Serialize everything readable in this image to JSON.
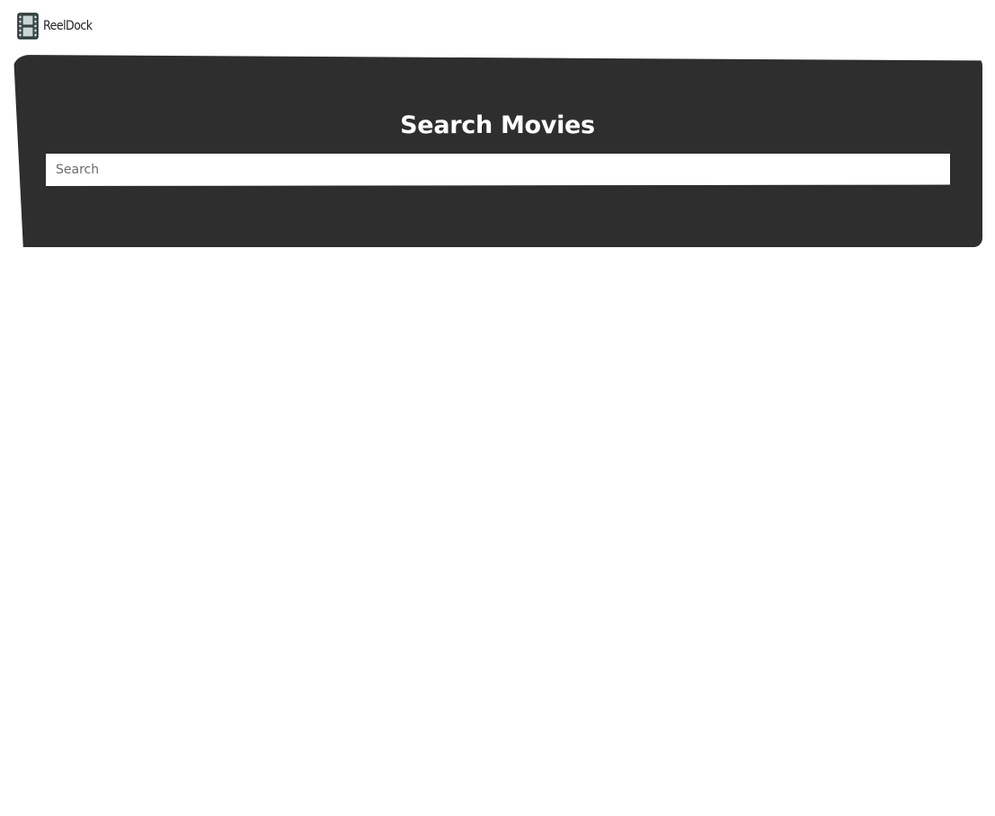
{
  "header": {
    "brand_name": "ReelDock",
    "logo_icon": "film-strip-icon"
  },
  "hero": {
    "title": "Search Movies",
    "search": {
      "placeholder": "Search",
      "value": ""
    }
  },
  "colors": {
    "hero_background": "#2e2e2e",
    "hero_text": "#ffffff",
    "page_background": "#ffffff",
    "brand_text": "#222222"
  }
}
